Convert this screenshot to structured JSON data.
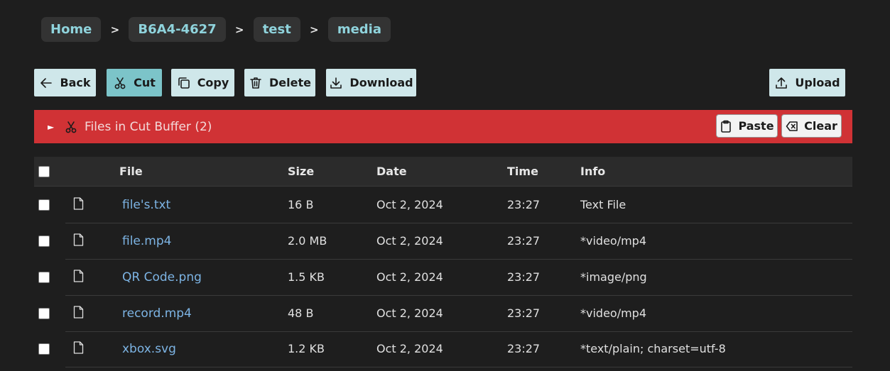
{
  "breadcrumb": {
    "items": [
      "Home",
      "B6A4-4627",
      "test",
      "media"
    ],
    "separator": ">"
  },
  "toolbar": {
    "back": "Back",
    "cut": "Cut",
    "copy": "Copy",
    "delete": "Delete",
    "download": "Download",
    "upload": "Upload"
  },
  "cut_buffer": {
    "title": "Files in Cut Buffer (2)",
    "paste": "Paste",
    "clear": "Clear",
    "color": "#d03235"
  },
  "table": {
    "headers": {
      "file": "File",
      "size": "Size",
      "date": "Date",
      "time": "Time",
      "info": "Info"
    },
    "rows": [
      {
        "name": "file's.txt",
        "size": "16 B",
        "date": "Oct 2, 2024",
        "time": "23:27",
        "info": "Text File"
      },
      {
        "name": "file.mp4",
        "size": "2.0 MB",
        "date": "Oct 2, 2024",
        "time": "23:27",
        "info": "*video/mp4"
      },
      {
        "name": "QR Code.png",
        "size": "1.5 KB",
        "date": "Oct 2, 2024",
        "time": "23:27",
        "info": "*image/png"
      },
      {
        "name": "record.mp4",
        "size": "48 B",
        "date": "Oct 2, 2024",
        "time": "23:27",
        "info": "*video/mp4"
      },
      {
        "name": "xbox.svg",
        "size": "1.2 KB",
        "date": "Oct 2, 2024",
        "time": "23:27",
        "info": "*text/plain; charset=utf-8"
      }
    ]
  },
  "colors": {
    "background": "#1e1e1e",
    "accent": "#8fd3dc",
    "button": "#cfe7ea",
    "button_active": "#7cc4c9",
    "link": "#7db4e4"
  }
}
